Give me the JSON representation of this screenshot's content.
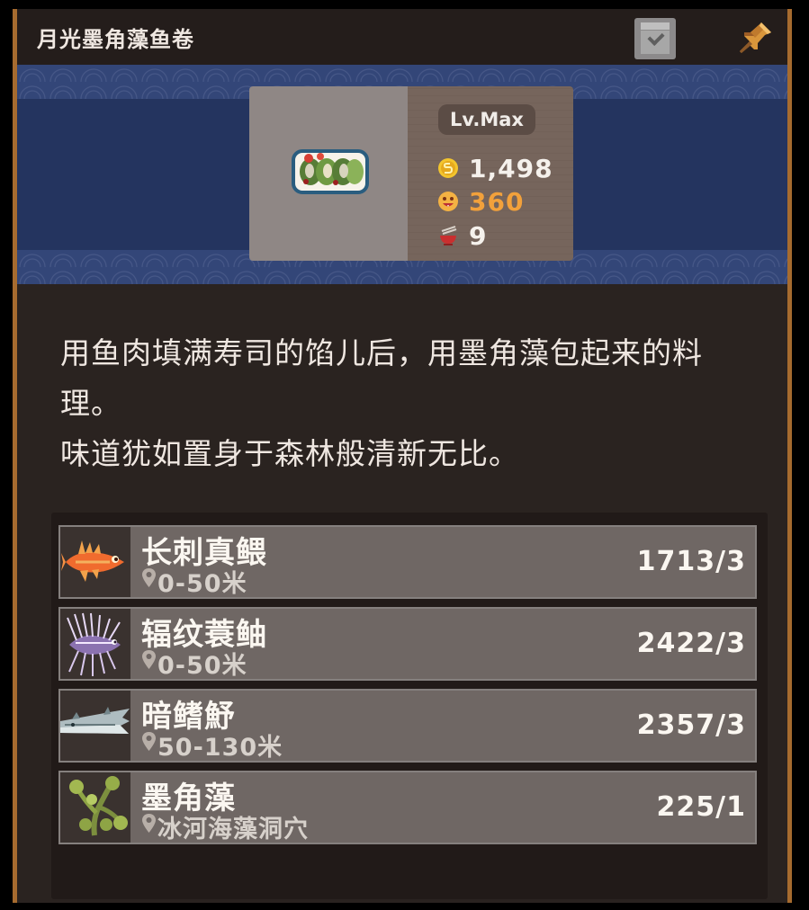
{
  "window": {
    "title": "月光墨角藻鱼卷"
  },
  "icons": {
    "checklist": "clipboard-check-icon",
    "pin": "pin-icon",
    "coin": "coin-icon",
    "taste": "taste-face-icon",
    "servings": "bowl-chopsticks-icon",
    "location": "location-pin-icon"
  },
  "dish": {
    "level": "Lv.Max",
    "price": "1,498",
    "taste": "360",
    "servings": "9"
  },
  "description": {
    "line1": "用鱼肉填满寿司的馅儿后，用墨角藻包起来的料理。",
    "line2": "味道犹如置身于森林般清新无比。"
  },
  "ingredients": [
    {
      "name": "长刺真鳂",
      "location": "0-50米",
      "count": "1713/3"
    },
    {
      "name": "辐纹蓑鲉",
      "location": "0-50米",
      "count": "2422/3"
    },
    {
      "name": "暗鳍魣",
      "location": "50-130米",
      "count": "2357/3"
    },
    {
      "name": "墨角藻",
      "location": "冰河海藻洞穴",
      "count": "225/1"
    }
  ],
  "colors": {
    "panel_bg": "#2a2320",
    "frame_orange": "#a66b2f",
    "banner_blue": "#24345f",
    "taste_orange": "#f2a13b",
    "text_light": "#efe7e1"
  }
}
